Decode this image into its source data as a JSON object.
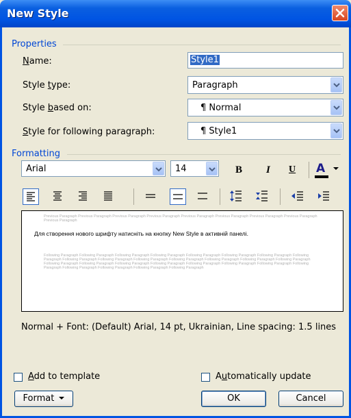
{
  "window": {
    "title": "New Style"
  },
  "properties": {
    "group_label": "Properties",
    "name_label": "Name:",
    "name_value": "Style1",
    "style_type_label": "Style type:",
    "style_type_value": "Paragraph",
    "based_on_label": "Style based on:",
    "based_on_value": "¶ Normal",
    "following_label": "Style for following paragraph:",
    "following_value": "¶ Style1"
  },
  "formatting": {
    "group_label": "Formatting",
    "font": "Arial",
    "size": "14",
    "bold": "B",
    "italic": "I",
    "underline": "U",
    "font_color": "A",
    "active_alignment": "left",
    "active_spacing": "1.5"
  },
  "preview": {
    "previous_text": "Previous Paragraph Previous Paragraph Previous Paragraph Previous Paragraph Previous Paragraph Previous Paragraph Previous Paragraph Previous Paragraph Previous Paragraph",
    "sample_text": "Для створення нового шрифту натисніть на кнопку New Style в активній панелі.",
    "following_text": "Following Paragraph Following Paragraph Following Paragraph Following Paragraph Following Paragraph Following Paragraph Following Paragraph Following Paragraph Following Paragraph Following Paragraph Following Paragraph Following Paragraph Following Paragraph Following Paragraph Following Paragraph Following Paragraph Following Paragraph Following Paragraph Following Paragraph Following Paragraph Following Paragraph Following Paragraph Following Paragraph Following Paragraph Following Paragraph Following Paragraph Following Paragraph"
  },
  "description": "Normal + Font: (Default) Arial, 14 pt, Ukrainian, Line spacing:  1.5 lines",
  "options": {
    "add_to_template": "Add to template",
    "add_to_template_checked": false,
    "auto_update": "Automatically update",
    "auto_update_checked": false
  },
  "buttons": {
    "format": "Format",
    "ok": "OK",
    "cancel": "Cancel"
  },
  "colors": {
    "accent": "#0054e3",
    "group_title": "#0046d5",
    "selection": "#316ac5",
    "font_color_bar": "#000000"
  }
}
